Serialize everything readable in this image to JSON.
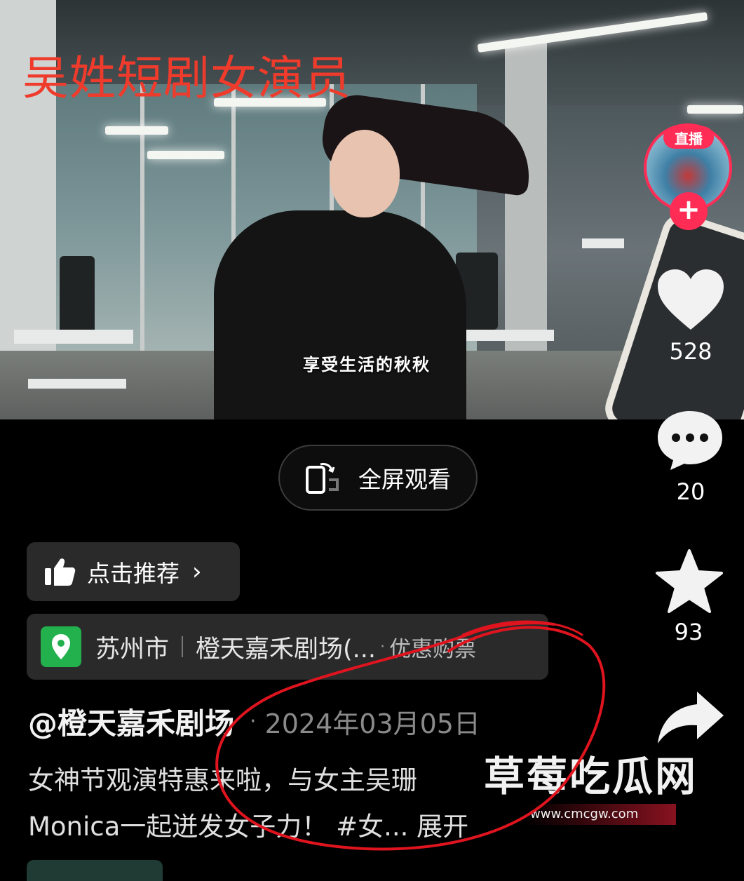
{
  "video": {
    "overlay_title": "吴姓短剧女演员",
    "subtitle": "享受生活的秋秋"
  },
  "right_rail": {
    "live_badge": "直播",
    "follow_symbol": "+",
    "like_count": "528",
    "comment_count": "20",
    "favorite_count": "93",
    "icons": [
      "heart-icon",
      "comment-icon",
      "star-icon",
      "share-icon"
    ]
  },
  "controls": {
    "fullscreen_label": "全屏观看",
    "recommend_label": "点击推荐",
    "recommend_chevron": "›"
  },
  "location": {
    "city": "苏州市",
    "venue": "橙天嘉禾剧场(...",
    "separator_dot": "·",
    "ticket": "优惠购票"
  },
  "post": {
    "author": "@橙天嘉禾剧场",
    "dot": "·",
    "date": "2024年03月05日",
    "description_line1": "女神节观演特惠来啦，与女主吴珊",
    "description_line2": "Monica一起迸发女子力！ #女...",
    "expand": "展开"
  },
  "watermark": {
    "text": "草莓吃瓜网",
    "url": "www.cmcgw.com"
  },
  "colors": {
    "accent_red": "#ff2c55",
    "title_red": "#ef3b2c",
    "location_green": "#22b14c",
    "annotation_red": "#e0141e"
  }
}
